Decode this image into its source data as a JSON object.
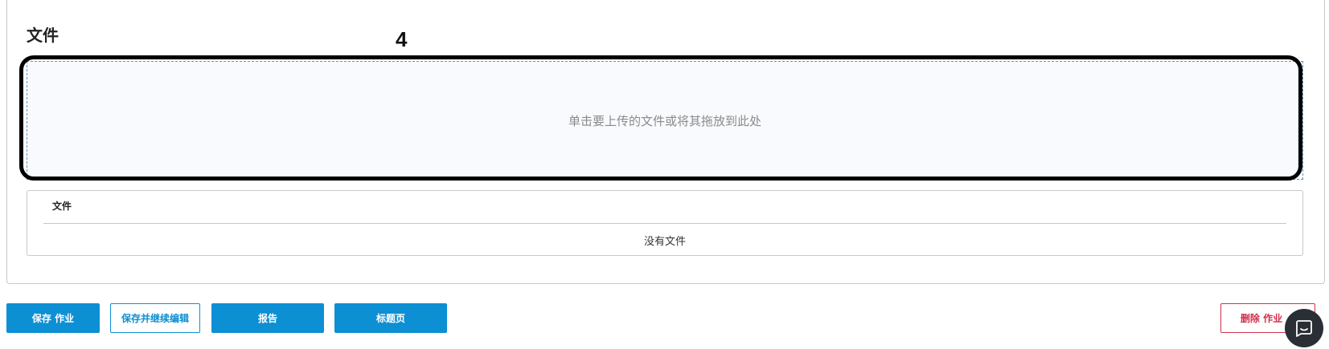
{
  "files_section": {
    "title": "文件",
    "annotation_number": "4",
    "dropzone_text": "单击要上传的文件或将其拖放到此处",
    "table": {
      "header": "文件",
      "empty_text": "没有文件"
    }
  },
  "actions": {
    "save": "保存 作业",
    "save_continue": "保存并继续编辑",
    "report": "报告",
    "title_page": "标题页",
    "delete": "删除 作业"
  },
  "colors": {
    "primary": "#0d8fd4",
    "danger": "#d0314a",
    "chat": "#2a2f36"
  },
  "icons": {
    "chat": "chat-bubble-icon"
  }
}
